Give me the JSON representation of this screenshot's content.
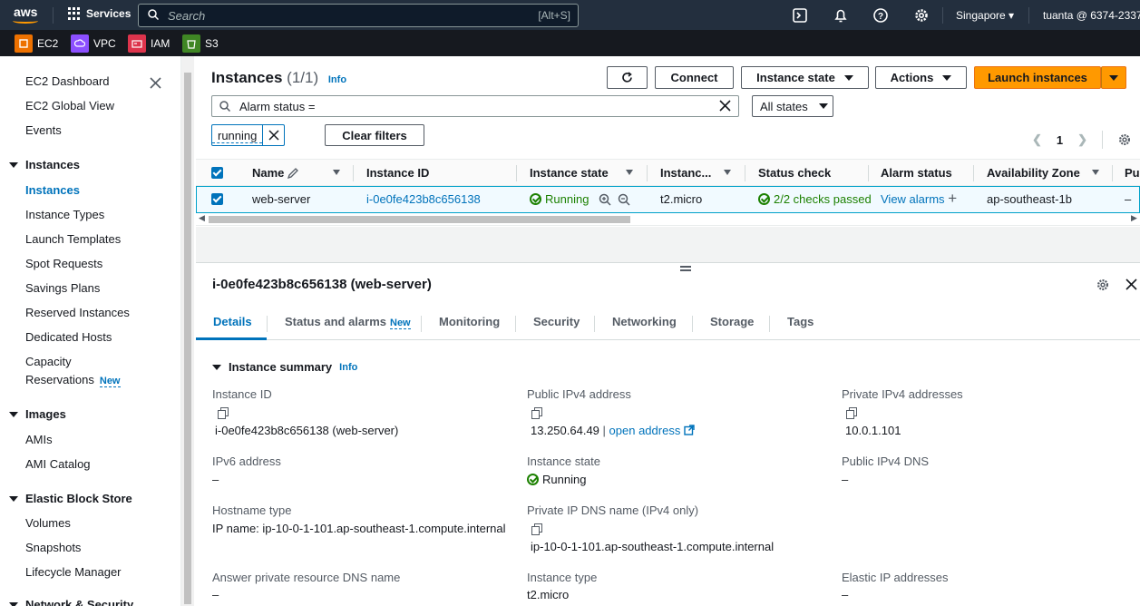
{
  "topnav": {
    "logo": "aws",
    "services_label": "Services",
    "search_placeholder": "Search",
    "search_shortcut": "[Alt+S]",
    "region": "Singapore",
    "account": "tuanta @ 6374-2337-"
  },
  "favorites": [
    {
      "label": "EC2",
      "color": "#ed7100",
      "icon": "ec2-icon"
    },
    {
      "label": "VPC",
      "color": "#8c4fff",
      "icon": "vpc-icon"
    },
    {
      "label": "IAM",
      "color": "#dd344c",
      "icon": "iam-icon"
    },
    {
      "label": "S3",
      "color": "#3f8624",
      "icon": "s3-icon"
    }
  ],
  "sidebar": {
    "top_items": [
      "EC2 Dashboard",
      "EC2 Global View",
      "Events"
    ],
    "instances_section": "Instances",
    "instances_items": [
      "Instances",
      "Instance Types",
      "Launch Templates",
      "Spot Requests",
      "Savings Plans",
      "Reserved Instances",
      "Dedicated Hosts",
      "Capacity",
      "Reservations"
    ],
    "new_badge": "New",
    "images_section": "Images",
    "images_items": [
      "AMIs",
      "AMI Catalog"
    ],
    "ebs_section": "Elastic Block Store",
    "ebs_items": [
      "Volumes",
      "Snapshots",
      "Lifecycle Manager"
    ],
    "network_section": "Network & Security"
  },
  "header": {
    "title": "Instances",
    "count": "(1/1)",
    "info": "Info",
    "connect": "Connect",
    "instance_state": "Instance state",
    "actions": "Actions",
    "launch": "Launch instances"
  },
  "filter": {
    "value": "Alarm status =",
    "states": "All states",
    "token": "running",
    "clear": "Clear filters",
    "page": "1"
  },
  "table": {
    "columns": [
      "Name",
      "Instance ID",
      "Instance state",
      "Instanc...",
      "Status check",
      "Alarm status",
      "Availability Zone",
      "Pu"
    ],
    "row": {
      "name": "web-server",
      "id": "i-0e0fe423b8c656138",
      "state": "Running",
      "type": "t2.micro",
      "status": "2/2 checks passed",
      "alarm": "View alarms",
      "az": "ap-southeast-1b",
      "pub": "–"
    }
  },
  "details": {
    "title": "i-0e0fe423b8c656138 (web-server)",
    "tabs": [
      "Details",
      "Status and alarms",
      "Monitoring",
      "Security",
      "Networking",
      "Storage",
      "Tags"
    ],
    "tab_new": "New",
    "summary": "Instance summary",
    "info": "Info",
    "fields": {
      "instance_id_label": "Instance ID",
      "instance_id": "i-0e0fe423b8c656138 (web-server)",
      "public_ipv4_label": "Public IPv4 address",
      "public_ipv4": "13.250.64.49",
      "open_address": "open address",
      "private_ipv4_label": "Private IPv4 addresses",
      "private_ipv4": "10.0.1.101",
      "ipv6_label": "IPv6 address",
      "ipv6": "–",
      "state_label": "Instance state",
      "state": "Running",
      "public_dns_label": "Public IPv4 DNS",
      "public_dns": "–",
      "hostname_label": "Hostname type",
      "hostname": "IP name: ip-10-0-1-101.ap-southeast-1.compute.internal",
      "private_dns_label": "Private IP DNS name (IPv4 only)",
      "private_dns": "ip-10-0-1-101.ap-southeast-1.compute.internal",
      "answer_dns_label": "Answer private resource DNS name",
      "answer_dns": "–",
      "type_label": "Instance type",
      "type": "t2.micro",
      "elastic_label": "Elastic IP addresses",
      "elastic": "–"
    }
  }
}
